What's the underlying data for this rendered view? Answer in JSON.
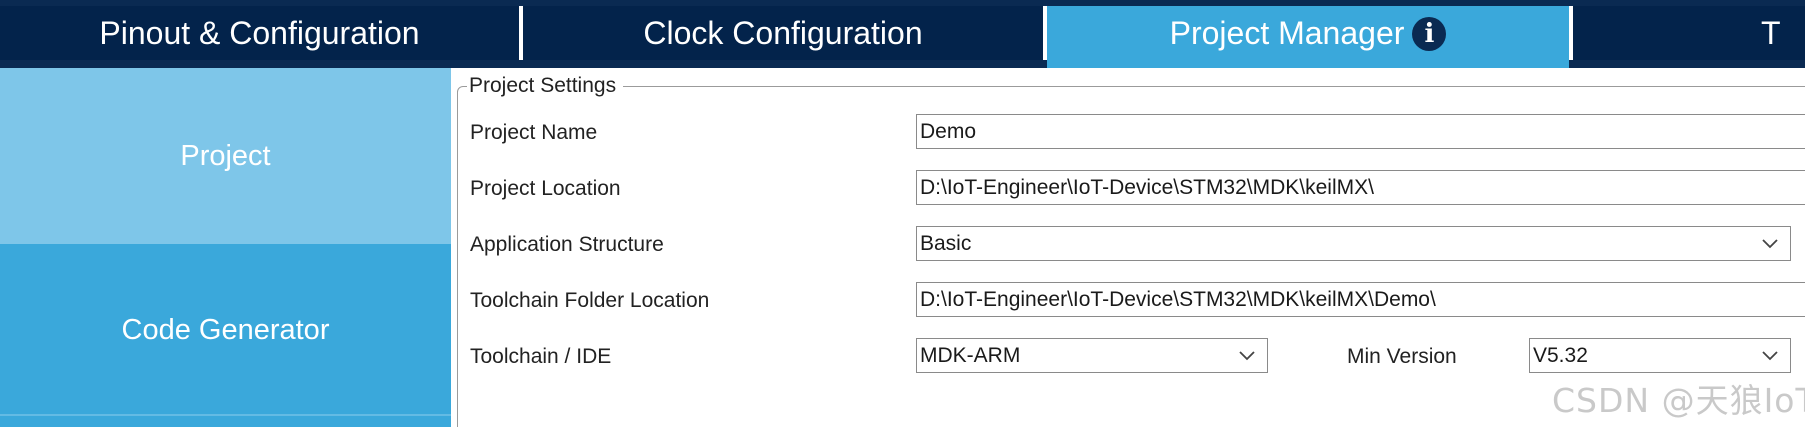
{
  "tabs": [
    {
      "label": "Pinout & Configuration"
    },
    {
      "label": "Clock Configuration"
    },
    {
      "label": "Project Manager"
    },
    {
      "label": "T"
    }
  ],
  "tab_info_icon": "info-icon",
  "colors": {
    "tab_bar": "#03234b",
    "tab_active": "#3aa8db",
    "nav_bg": "#3aa8db",
    "nav_selected": "#7ec6e9"
  },
  "nav": {
    "items": [
      {
        "label": "Project",
        "selected": true
      },
      {
        "label": "Code Generator",
        "selected": false
      }
    ]
  },
  "project_settings": {
    "legend": "Project Settings",
    "project_name": {
      "label": "Project Name",
      "value": "Demo"
    },
    "project_location": {
      "label": "Project Location",
      "value": "D:\\IoT-Engineer\\IoT-Device\\STM32\\MDK\\keilMX\\"
    },
    "application_structure": {
      "label": "Application Structure",
      "value": "Basic"
    },
    "toolchain_folder": {
      "label": "Toolchain Folder Location",
      "value": "D:\\IoT-Engineer\\IoT-Device\\STM32\\MDK\\keilMX\\Demo\\"
    },
    "toolchain_ide": {
      "label": "Toolchain / IDE",
      "value": "MDK-ARM"
    },
    "min_version": {
      "label": "Min Version",
      "value": "V5.32"
    }
  },
  "watermark": "CSDN @天狼IoT"
}
